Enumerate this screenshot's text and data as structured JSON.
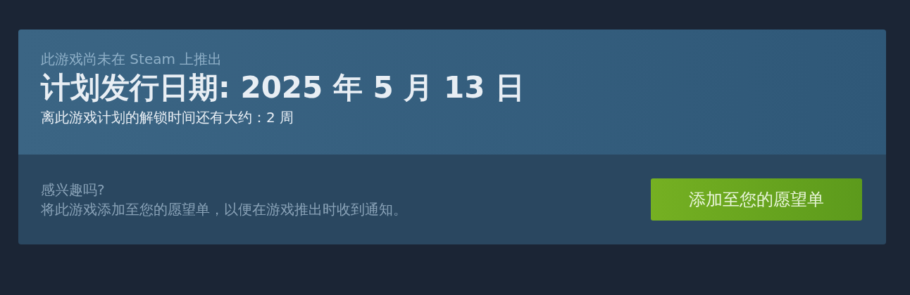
{
  "release": {
    "notice": "此游戏尚未在 Steam 上推出",
    "title": "计划发行日期: 2025 年 5 月 13 日",
    "countdown": "离此游戏计划的解锁时间还有大约：2 周"
  },
  "wishlist": {
    "question": "感兴趣吗?",
    "description": "将此游戏添加至您的愿望单，以便在游戏推出时收到通知。",
    "button": "添加至您的愿望单"
  }
}
